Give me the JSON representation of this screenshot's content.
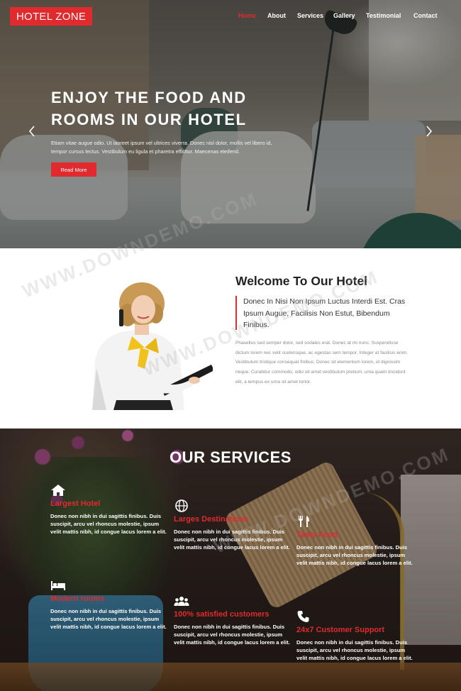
{
  "brand": {
    "logo": "HOTEL ZONE",
    "accent_color": "#e02a2e"
  },
  "nav": {
    "items": [
      {
        "label": "Home",
        "active": true
      },
      {
        "label": "About"
      },
      {
        "label": "Services"
      },
      {
        "label": "Gallery"
      },
      {
        "label": "Testimonial"
      },
      {
        "label": "Contact"
      }
    ]
  },
  "hero": {
    "title_line1": "ENJOY THE FOOD AND",
    "title_line2": "ROOMS IN OUR HOTEL",
    "subtitle_line1": "Etiam vitae augue odio. Ut laoreet ipsum vel ultrices viverra. Donec nisl dolor, mollis vel libero id,",
    "subtitle_line2": "tempor cursus lectus. Vestibulum eu ligula et pharetra efficitur. Maecenas eleifend.",
    "button": "Read More",
    "prev_icon": "chevron-left-icon",
    "next_icon": "chevron-right-icon"
  },
  "welcome": {
    "title": "Welcome To Our Hotel",
    "lead": "Donec In Nisi Non Ipsum Luctus Interdi Est. Cras Ipsum Augue, Facilisis Non Estut, Bibendum Finibus.",
    "body": "Phasellus sed semper dolor, sed sodales erat. Donec at mi nunc. Suspendisse dictum lorem nec velit scelerisque, ac egestas sem tempor. Integer at facilisis enim. Vestibulum tristique consequat finibus. Donec sit elementum lorem, id dignissim neque. Curabitur commodo, odio sit amet vestibulum pretium, urna quam tincidunt elit, a tempus ex urna sit amet tortor."
  },
  "services": {
    "title": "OUR SERVICES",
    "items": [
      {
        "icon": "home-icon",
        "name": "Largest Hotel",
        "desc": "Donec non nibh in dui sagittis finibus. Duis suscipit, arcu vel rhoncus molestie, ipsum velit mattis nibh, id congue lacus lorem a elit."
      },
      {
        "icon": "globe-icon",
        "name": "Larges Destinations",
        "desc": "Donec non nibh in dui sagittis finibus. Duis suscipit, arcu vel rhoncus molestie, ipsum velit mattis nibh, id congue lacus lorem a elit."
      },
      {
        "icon": "cutlery-icon",
        "name": "Tasty Food",
        "desc": "Donec non nibh in dui sagittis finibus. Duis suscipit, arcu vel rhoncus molestie, ipsum velit mattis nibh, id congue lacus lorem a elit."
      },
      {
        "icon": "bed-icon",
        "name": "Modern rooms",
        "desc": "Donec non nibh in dui sagittis finibus. Duis suscipit, arcu vel rhoncus molestie, ipsum velit mattis nibh, id congue lacus lorem a elit."
      },
      {
        "icon": "users-icon",
        "name": "100% satisfied customers",
        "desc": "Donec non nibh in dui sagittis finibus. Duis suscipit, arcu vel rhoncus molestie, ipsum velit mattis nibh, id congue lacus lorem a elit."
      },
      {
        "icon": "phone-icon",
        "name": "24x7 Customer Support",
        "desc": "Donec non nibh in dui sagittis finibus. Duis suscipit, arcu vel rhoncus molestie, ipsum velit mattis nibh, id congue lacus lorem a elit."
      }
    ]
  },
  "watermark": {
    "text": "WWW.DOWNDEMO.COM"
  }
}
